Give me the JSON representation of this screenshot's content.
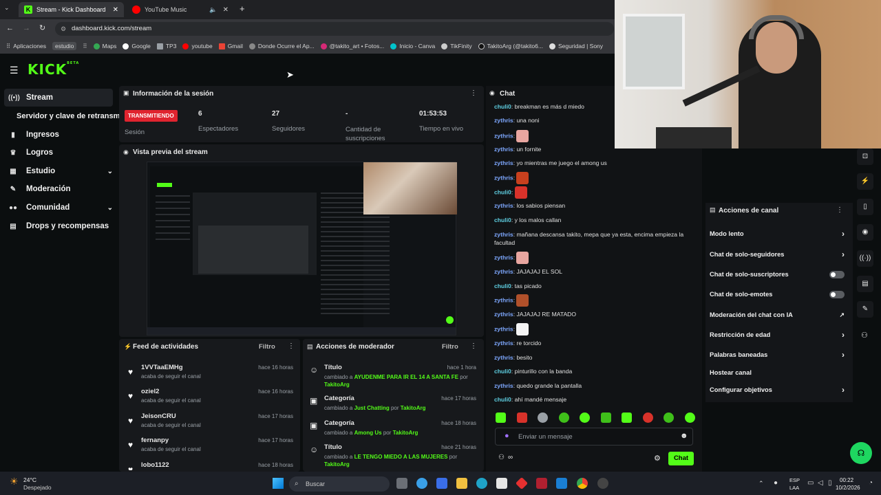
{
  "browser": {
    "tabs": [
      {
        "label": "Stream - Kick Dashboard"
      },
      {
        "label": "YouTube Music"
      }
    ],
    "url": "dashboard.kick.com/stream",
    "bookmarks": [
      "Aplicaciones",
      "estudio",
      "Maps",
      "Google",
      "TP3",
      "youtube",
      "Gmail",
      "Donde Ocurre el Ap...",
      "@takito_art • Fotos...",
      "Inicio - Canva",
      "TikFinity",
      "TakitoArg (@takito6...",
      "Seguridad | Sony"
    ]
  },
  "logo": "KICK",
  "logo_sup": "BETA",
  "sidebar": {
    "items": [
      {
        "label": "Stream",
        "icon": "stream-icon"
      },
      {
        "label": "Servidor y clave de retransm",
        "icon": ""
      },
      {
        "label": "Ingresos",
        "icon": "chart-icon"
      },
      {
        "label": "Logros",
        "icon": "trophy-icon"
      },
      {
        "label": "Estudio",
        "icon": "grid-icon"
      },
      {
        "label": "Moderación",
        "icon": "wrench-icon"
      },
      {
        "label": "Comunidad",
        "icon": "people-icon"
      },
      {
        "label": "Drops y recompensas",
        "icon": "gift-icon"
      }
    ]
  },
  "session": {
    "title": "Información de la sesión",
    "live_badge": "TRANSMITIENDO",
    "session_label": "Sesión",
    "stats": [
      {
        "value": "6",
        "label": "Espectadores"
      },
      {
        "value": "27",
        "label": "Seguidores"
      },
      {
        "value": "-",
        "label": "Cantidad de suscripciones"
      },
      {
        "value": "01:53:53",
        "label": "Tiempo en vivo"
      }
    ]
  },
  "preview": {
    "title": "Vista previa del stream"
  },
  "activity": {
    "title": "Feed de actividades",
    "filter": "Filtro",
    "items": [
      {
        "name": "1VVTaaEMHg",
        "action": "acaba de seguir el canal",
        "time": "hace 16 horas"
      },
      {
        "name": "oziel2",
        "action": "acaba de seguir el canal",
        "time": "hace 16 horas"
      },
      {
        "name": "JeisonCRU",
        "action": "acaba de seguir el canal",
        "time": "hace 17 horas"
      },
      {
        "name": "fernanpy",
        "action": "acaba de seguir el canal",
        "time": "hace 17 horas"
      },
      {
        "name": "lobo1122",
        "action": "",
        "time": "hace 18 horas"
      }
    ]
  },
  "modactions": {
    "title": "Acciones de moderador",
    "filter": "Filtro",
    "items": [
      {
        "kind": "Título",
        "pre": "cambiado a",
        "val": "AYUDENME PARA IR EL 14 A SANTA FE",
        "by": "por",
        "user": "TakitoArg",
        "time": "hace 1 hora"
      },
      {
        "kind": "Categoría",
        "pre": "cambiado a",
        "val": "Just Chatting",
        "by": "por",
        "user": "TakitoArg",
        "time": "hace 17 horas"
      },
      {
        "kind": "Categoría",
        "pre": "cambiado a",
        "val": "Among Us",
        "by": "por",
        "user": "TakitoArg",
        "time": "hace 18 horas"
      },
      {
        "kind": "Título",
        "pre": "cambiado a",
        "val": "LE TENGO MIEDO A LAS MUJERES",
        "by": "por",
        "user": "TakitoArg",
        "time": "hace 21 horas"
      }
    ]
  },
  "chat": {
    "title": "Chat",
    "messages": [
      {
        "user": "chuli0",
        "text": "breakman es más d miedo"
      },
      {
        "user": "zythris",
        "text": "una noni"
      },
      {
        "user": "zythris",
        "text": "",
        "emote": "#e8a6a0"
      },
      {
        "user": "zythris",
        "text": "un fornite"
      },
      {
        "user": "zythris",
        "text": "yo mientras me juego el among us"
      },
      {
        "user": "zythris",
        "text": "",
        "emote": "#c8401e"
      },
      {
        "user": "chuli0",
        "text": "",
        "emote": "#d8322a"
      },
      {
        "user": "zythris",
        "text": "los sabios piensan"
      },
      {
        "user": "chuli0",
        "text": "y los malos callan"
      },
      {
        "user": "zythris",
        "text": "mañana descansa takito, mepa que ya esta, encima empieza la facultad"
      },
      {
        "user": "zythris",
        "text": "",
        "emote": "#e8a6a0"
      },
      {
        "user": "zythris",
        "text": "JAJAJAJ EL SOL"
      },
      {
        "user": "chuli0",
        "text": "tas picado"
      },
      {
        "user": "zythris",
        "text": "",
        "emote": "#b0502a"
      },
      {
        "user": "zythris",
        "text": "JAJAJAJ RE MATADO"
      },
      {
        "user": "zythris",
        "text": "",
        "emote": "#f4f4f4"
      },
      {
        "user": "zythris",
        "text": "re torcido"
      },
      {
        "user": "zythris",
        "text": "besito"
      },
      {
        "user": "chuli0",
        "text": "pinturillo con la banda"
      },
      {
        "user": "zythris",
        "text": "quedo grande la pantalla"
      },
      {
        "user": "chuli0",
        "text": "ahí mandé mensaje"
      }
    ],
    "placeholder": "Enviar un mensaje",
    "send": "Chat"
  },
  "channel_actions": {
    "title": "Acciones de canal",
    "items": [
      {
        "label": "Modo lento",
        "ctrl": "arrow"
      },
      {
        "label": "Chat de solo-seguidores",
        "ctrl": "arrow"
      },
      {
        "label": "Chat de solo-suscriptores",
        "ctrl": "toggle"
      },
      {
        "label": "Chat de solo-emotes",
        "ctrl": "toggle"
      },
      {
        "label": "Moderación del chat con IA",
        "ctrl": "external"
      },
      {
        "label": "Restricción de edad",
        "ctrl": "arrow"
      },
      {
        "label": "Palabras baneadas",
        "ctrl": "arrow"
      },
      {
        "label": "Hostear canal",
        "ctrl": "none"
      },
      {
        "label": "Configurar objetivos",
        "ctrl": "arrow"
      }
    ]
  },
  "taskbar": {
    "temp": "24°C",
    "weather": "Despejado",
    "search": "Buscar",
    "lang1": "ESP",
    "lang2": "LAA",
    "time": "00:22",
    "date": "10/2/2026"
  },
  "colors": {
    "accent": "#53fc18",
    "live": "#e0242f",
    "bg": "#0b0e0f",
    "panel": "#17191c"
  }
}
